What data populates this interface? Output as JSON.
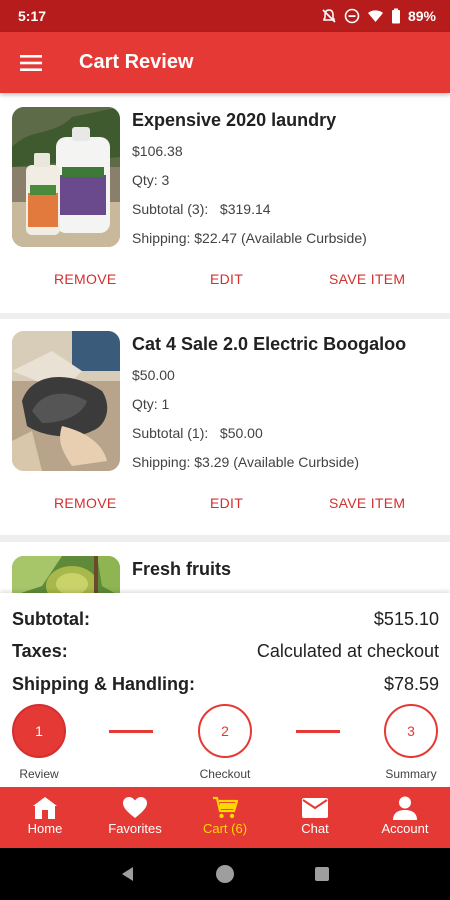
{
  "status_bar": {
    "time": "5:17",
    "battery": "89%"
  },
  "app_bar": {
    "title": "Cart Review"
  },
  "cart_items": [
    {
      "title": "Expensive 2020 laundry",
      "price": "$106.38",
      "qty": "Qty: 3",
      "subtotal": "Subtotal (3):   $319.14",
      "shipping": "Shipping: $22.47 (Available Curbside)",
      "remove_label": "REMOVE",
      "edit_label": "EDIT",
      "save_label": "SAVE ITEM"
    },
    {
      "title": "Cat 4 Sale 2.0 Electric Boogaloo",
      "price": "$50.00",
      "qty": "Qty: 1",
      "subtotal": "Subtotal (1):   $50.00",
      "shipping": "Shipping: $3.29 (Available Curbside)",
      "remove_label": "REMOVE",
      "edit_label": "EDIT",
      "save_label": "SAVE ITEM"
    },
    {
      "title": "Fresh fruits"
    }
  ],
  "totals": {
    "subtotal_label": "Subtotal:",
    "subtotal_value": "$515.10",
    "taxes_label": "Taxes:",
    "taxes_value": "Calculated at checkout",
    "shipping_label": "Shipping & Handling:",
    "shipping_value": "$78.59"
  },
  "steps": [
    {
      "number": "1",
      "label": "Review",
      "active": true
    },
    {
      "number": "2",
      "label": "Checkout",
      "active": false
    },
    {
      "number": "3",
      "label": "Summary",
      "active": false
    }
  ],
  "bottom_nav": [
    {
      "label": "Home",
      "icon": "home-icon"
    },
    {
      "label": "Favorites",
      "icon": "heart-icon"
    },
    {
      "label": "Cart (6)",
      "icon": "cart-icon",
      "active": true
    },
    {
      "label": "Chat",
      "icon": "mail-icon"
    },
    {
      "label": "Account",
      "icon": "account-icon"
    }
  ],
  "colors": {
    "primary": "#e53935",
    "status_bar": "#b71c1c",
    "active_nav": "#ffd600"
  }
}
